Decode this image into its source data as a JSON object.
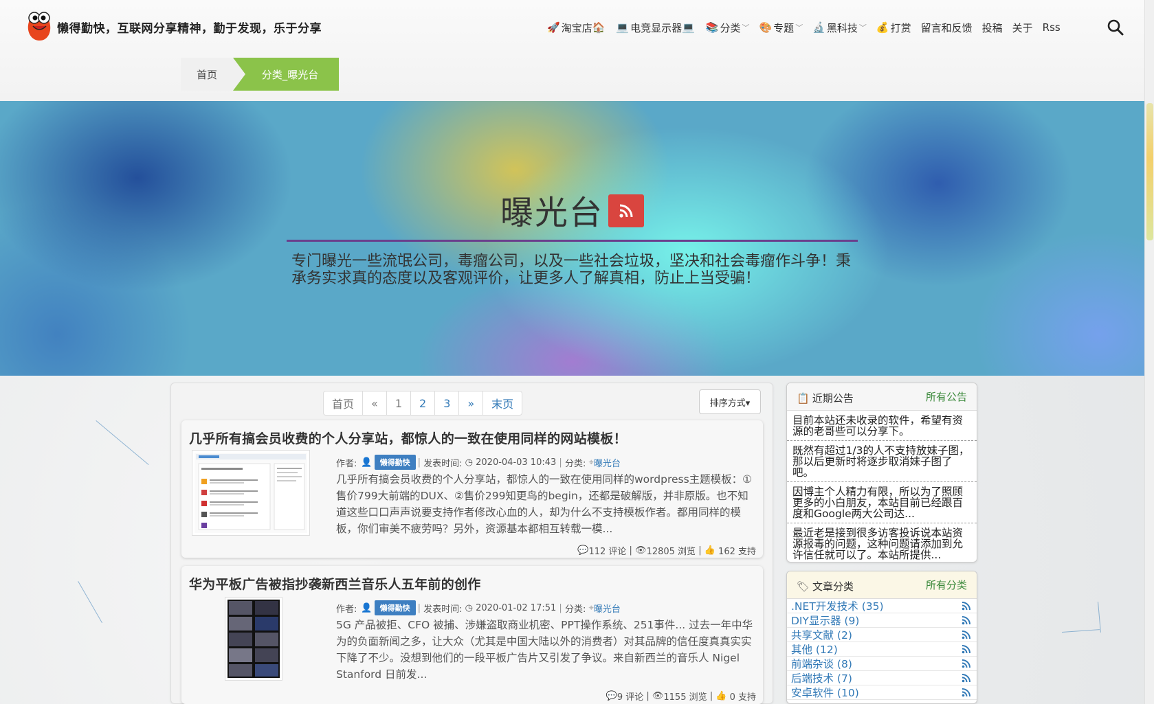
{
  "header": {
    "site_title": "懒得勤快，互联网分享精神，勤于发现，乐于分享",
    "nav": [
      {
        "label": "淘宝店",
        "icon": "rocket-icon",
        "tail_icon": "house-icon",
        "dropdown": false
      },
      {
        "label": "电竞显示器",
        "icon": "laptop-icon",
        "tail_icon": "laptop-icon",
        "dropdown": false
      },
      {
        "label": "分类",
        "icon": "book-icon",
        "tail_icon": "",
        "dropdown": true
      },
      {
        "label": "专题",
        "icon": "palette-icon",
        "tail_icon": "",
        "dropdown": true
      },
      {
        "label": "黑科技",
        "icon": "microscope-icon",
        "tail_icon": "",
        "dropdown": true
      },
      {
        "label": "打赏",
        "icon": "moneybag-icon",
        "tail_icon": "",
        "dropdown": false
      },
      {
        "label": "留言和反馈",
        "icon": "",
        "tail_icon": "",
        "dropdown": false
      },
      {
        "label": "投稿",
        "icon": "",
        "tail_icon": "",
        "dropdown": false
      },
      {
        "label": "关于",
        "icon": "",
        "tail_icon": "",
        "dropdown": false
      },
      {
        "label": "Rss",
        "icon": "",
        "tail_icon": "",
        "dropdown": false
      }
    ]
  },
  "breadcrumb": {
    "home": "首页",
    "current": "分类_曝光台"
  },
  "banner": {
    "title": "曝光台",
    "description": "专门曝光一些流氓公司，毒瘤公司，以及一些社会垃圾，坚决和社会毒瘤作斗争！秉承务实求真的态度以及客观评价，让更多人了解真相，防止上当受骗！"
  },
  "pager": {
    "first": "首页",
    "prev": "«",
    "pages": [
      "1",
      "2",
      "3"
    ],
    "next": "»",
    "last": "末页",
    "current": "1"
  },
  "sort": {
    "label": "排序方式▾"
  },
  "posts": [
    {
      "title": "几乎所有搞会员收费的个人分享站，都惊人的一致在使用同样的网站模板！",
      "author_label": "作者:",
      "author": "懒得勤快",
      "date_label": "发表时间:",
      "date": "2020-04-03 10:43",
      "cat_label": "分类:",
      "category": "曝光台",
      "excerpt": "几乎所有搞会员收费的个人分享站，都惊人的一致在使用同样的wordpress主题模板：①售价799大前端的DUX、②售价299知更鸟的begin，还都是破解版，并非原版。也不知道这些口口声声说要支持作者修改心血的人，却为什么不支持模板作者。都用同样的模板，你们审美不疲劳吗？另外，资源基本都相互转载一模...",
      "comments": "112 评论",
      "views": "12805 浏览",
      "likes": "162 支持"
    },
    {
      "title": "华为平板广告被指抄袭新西兰音乐人五年前的创作",
      "author_label": "作者:",
      "author": "懒得勤快",
      "date_label": "发表时间:",
      "date": "2020-01-02 17:51",
      "cat_label": "分类:",
      "category": "曝光台",
      "excerpt": "5G 产品被拒、CFO 被捕、涉嫌盗取商业机密、PPT操作系统、251事件... 过去一年中华为的负面新闻之多，让大众（尤其是中国大陆以外的消费者）对其品牌的信任度真真实实下降了不少。没想到他们的一段平板广告片又引发了争议。来自新西兰的音乐人 Nigel Stanford 日前发...",
      "comments": "9 评论",
      "views": "1155 浏览",
      "likes": "0 支持"
    }
  ],
  "sidebar": {
    "notice": {
      "title": "近期公告",
      "more": "所有公告",
      "items": [
        "目前本站还未收录的软件，希望有资源的老哥些可以分享下。",
        "既然有超过1/3的人不支持放妹子图，那以后更新时将逐步取消妹子图了吧。",
        "因博主个人精力有限，所以为了照顾更多的小白朋友，本站目前已经跟百度和Google两大公司达...",
        "最近老是接到很多访客投诉说本站资源报毒的问题，这种问题请添加到允许信任就可以了。本站所提供..."
      ]
    },
    "categories": {
      "title": "文章分类",
      "more": "所有分类",
      "items": [
        ".NET开发技术 (35)",
        "DIY显示器 (9)",
        "共享文献 (2)",
        "其他 (12)",
        "前端杂谈 (8)",
        "后端技术 (7)",
        "安卓软件 (10)"
      ]
    }
  },
  "colors": {
    "accent_green": "#8bc34a",
    "rss_red": "#d9453f",
    "link_blue": "#337ab7",
    "author_tag_blue": "#3e7fc1",
    "banner_line": "#6a3e8c"
  }
}
